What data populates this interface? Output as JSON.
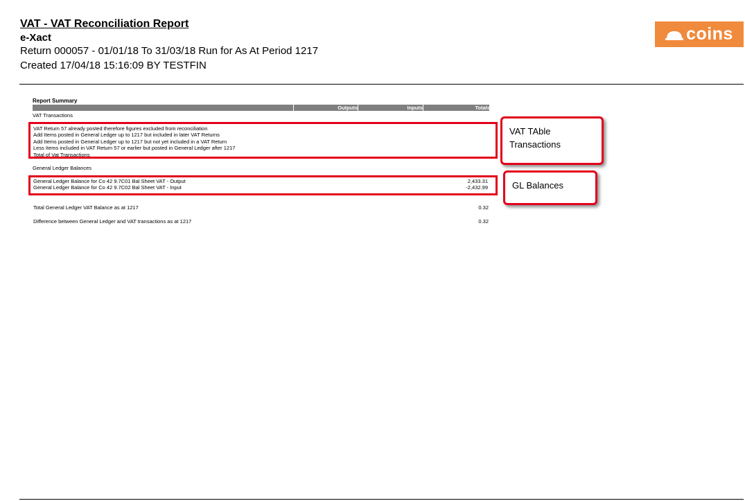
{
  "header": {
    "title": "VAT - VAT Reconciliation Report",
    "subtitle": "e-Xact",
    "return_line": "Return 000057 - 01/01/18 To 31/03/18 Run for As At Period 1217",
    "created_line": "Created 17/04/18 15:16:09 BY TESTFIN"
  },
  "logo": {
    "text": "coins",
    "color": "#f08a3c"
  },
  "report": {
    "summary_title": "Report Summary",
    "columns": [
      "Outputs",
      "Inputs",
      "Totals"
    ],
    "vat_heading": "VAT Transactions",
    "vat_rows": [
      "VAT Return 57 already posted therefore figures excluded from reconciliation",
      "Add Items posted in General Ledger up to 1217 but included in later VAT Returns",
      "Add Items posted in General Ledger up to 1217 but not yet included in a VAT Return",
      "Less Items included in VAT Return 57 or earlier but posted in General Ledger after 1217",
      "Total of Vat Transactions"
    ],
    "gl_heading": "General Ledger Balances",
    "gl_rows": [
      {
        "label": "General Ledger Balance for Co 42 9.7C01 Bal Sheet VAT - Output",
        "value": "2,433.31"
      },
      {
        "label": "General Ledger Balance for Co 42 9.7C02 Bal Sheet VAT - Input",
        "value": "-2,432.99"
      }
    ],
    "total_label": "Total General Ledger VAT Balance as at 1217",
    "total_value": "0.32",
    "difference_label": "Difference between General Ledger and VAT transactions as at 1217",
    "difference_value": "0.32"
  },
  "annotations": {
    "highlight_color": "#e3001b",
    "vat_callout_line1": "VAT TAble",
    "vat_callout_line2": "Transactions",
    "gl_callout": "GL Balances"
  }
}
